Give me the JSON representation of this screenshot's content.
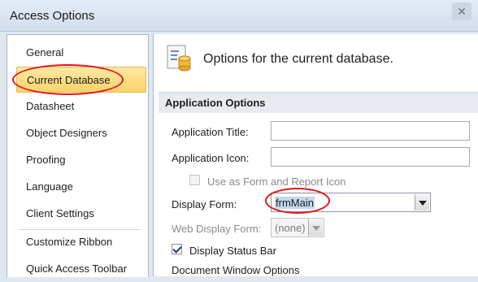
{
  "window": {
    "title": "Access Options"
  },
  "nav": {
    "items": [
      {
        "label": "General"
      },
      {
        "label": "Current Database"
      },
      {
        "label": "Datasheet"
      },
      {
        "label": "Object Designers"
      },
      {
        "label": "Proofing"
      },
      {
        "label": "Language"
      },
      {
        "label": "Client Settings"
      },
      {
        "label": "Customize Ribbon"
      },
      {
        "label": "Quick Access Toolbar"
      }
    ],
    "selected": "Current Database"
  },
  "content": {
    "header": "Options for the current database.",
    "header_icon": "database-options-icon",
    "section_title": "Application Options",
    "app_title_label": "Application Title:",
    "app_title_value": "",
    "app_icon_label": "Application Icon:",
    "app_icon_value": "",
    "use_as_icon_label": "Use as Form and Report Icon",
    "use_as_icon_checked": false,
    "display_form_label": "Display Form:",
    "display_form_value": "frmMain",
    "web_display_form_label": "Web Display Form:",
    "web_display_form_value": "(none)",
    "status_bar_label": "Display Status Bar",
    "status_bar_checked": true,
    "doc_window_label": "Document Window Options"
  },
  "colors": {
    "highlight": "#fcd36a",
    "annotation": "#e0141b",
    "selection": "#c3d7ef"
  }
}
